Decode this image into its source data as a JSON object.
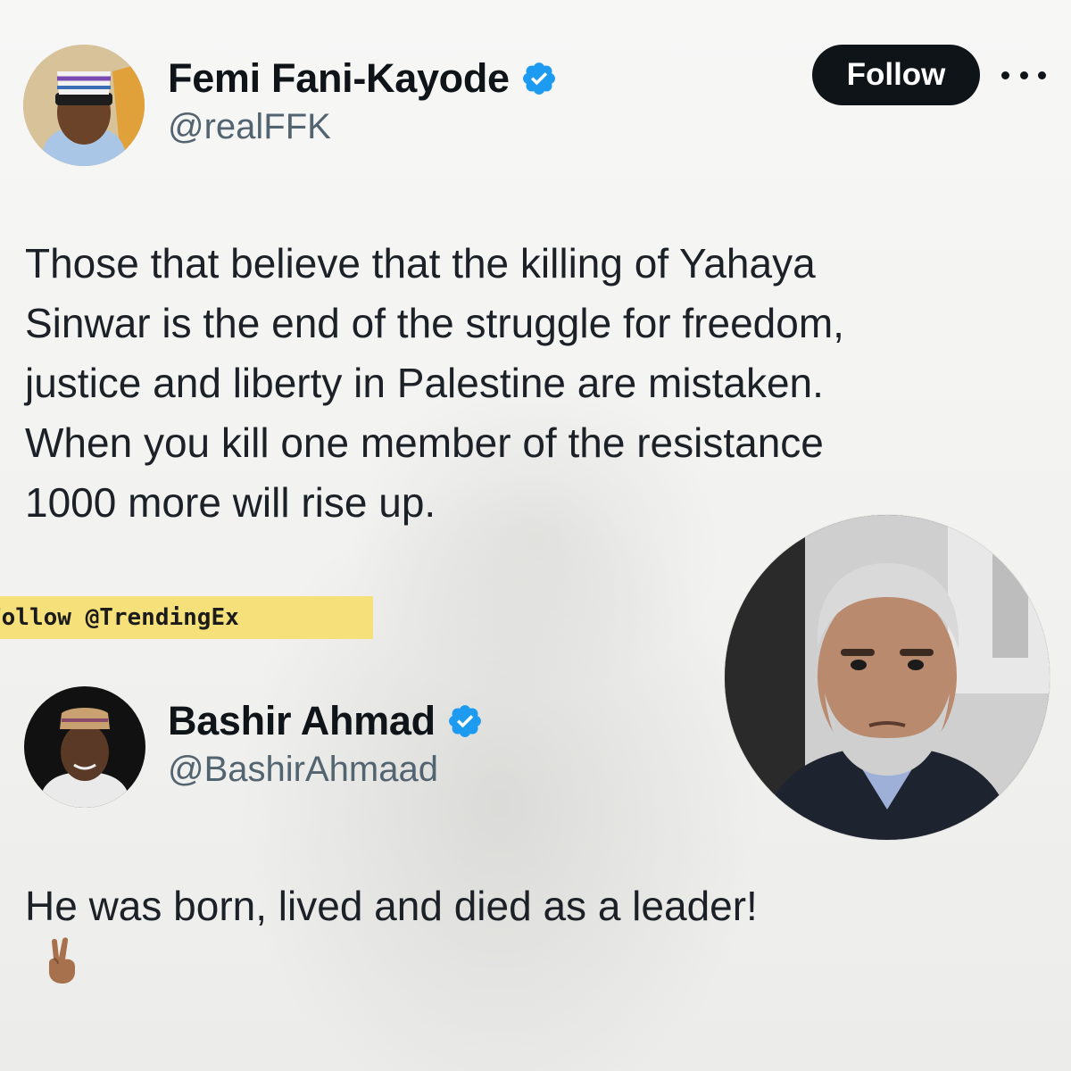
{
  "tweet1": {
    "display_name": "Femi Fani-Kayode",
    "handle": "@realFFK",
    "follow_label": "Follow",
    "text_lines": [
      "Those that believe that the killing of Yahaya",
      "Sinwar is the end of the struggle for freedom,",
      "justice and liberty in Palestine are mistaken.",
      "When you kill one member of the resistance",
      "1000 more will rise up."
    ]
  },
  "promo": {
    "label": "Follow @TrendingEx"
  },
  "tweet2": {
    "display_name": "Bashir Ahmad",
    "handle": "@BashirAhmaad",
    "text": "He was born, lived and died as a leader!"
  },
  "icons": {
    "verified": "verified-badge-icon",
    "more": "more-options-icon",
    "emoji": "victory-hand-emoji"
  },
  "colors": {
    "verified_blue": "#1d9bf0",
    "follow_bg": "#0f1419",
    "banner_yellow": "#f5e07a",
    "handle_gray": "#536471"
  }
}
